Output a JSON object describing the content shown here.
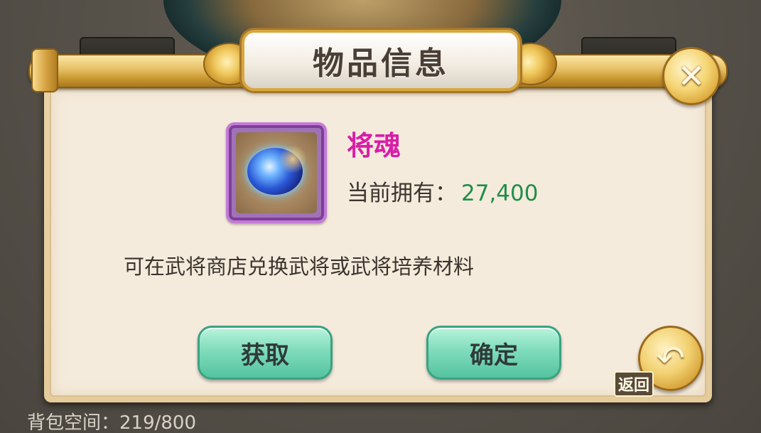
{
  "dialog": {
    "title": "物品信息",
    "close_icon": "close-icon",
    "item": {
      "name": "将魂",
      "icon": "dragon-soul-orb-icon",
      "owned_label": "当前拥有：",
      "owned_value": "27,400",
      "description": "可在武将商店兑换武将或武将培养材料"
    },
    "buttons": {
      "get_label": "获取",
      "confirm_label": "确定"
    },
    "return_label": "返回"
  },
  "footer": {
    "bag_space": "背包空间：219/800"
  },
  "colors": {
    "item_name": "#d81ea8",
    "owned_value": "#1e8f4a",
    "button_bg": "#7fdcbc",
    "frame_purple": "#c37ad8"
  }
}
